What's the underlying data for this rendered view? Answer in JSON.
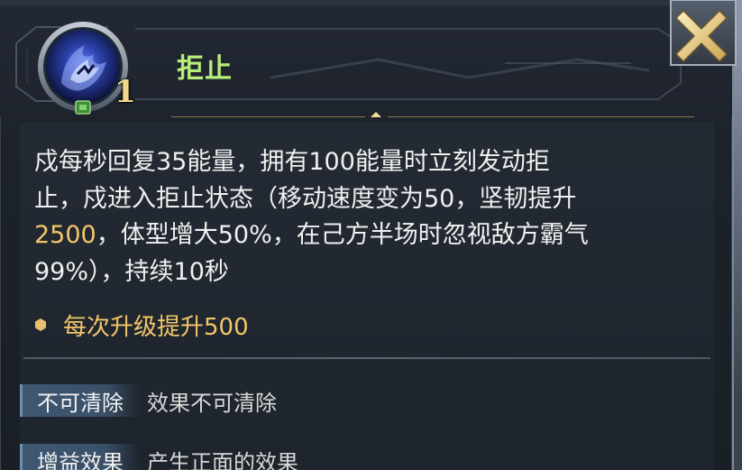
{
  "skill": {
    "name": "拒止",
    "level": "1"
  },
  "description": {
    "line1": "戍每秒回复35能量，拥有100能量时立刻发动拒",
    "line2": "止，戍进入拒止状态（移动速度变为50，坚韧提升",
    "line3_highlight": "2500",
    "line3_rest": "，体型增大50%，在己方半场时忽视敌方霸气",
    "line4": "99%），持续10秒"
  },
  "upgrade": {
    "text": "每次升级提升500"
  },
  "tags": [
    {
      "label": "不可清除",
      "desc": "效果不可清除"
    },
    {
      "label": "增益效果",
      "desc": "产生正面的效果"
    }
  ],
  "colors": {
    "skill_name": "#b7ed7a",
    "highlight": "#f2c76a",
    "body_text": "#f0f0f0",
    "tag_bg": "#3f5873"
  },
  "icons": {
    "skill": "blue-wolf-flame-skill-icon",
    "close": "close-x-icon",
    "bullet": "hexagon-bullet-icon"
  }
}
